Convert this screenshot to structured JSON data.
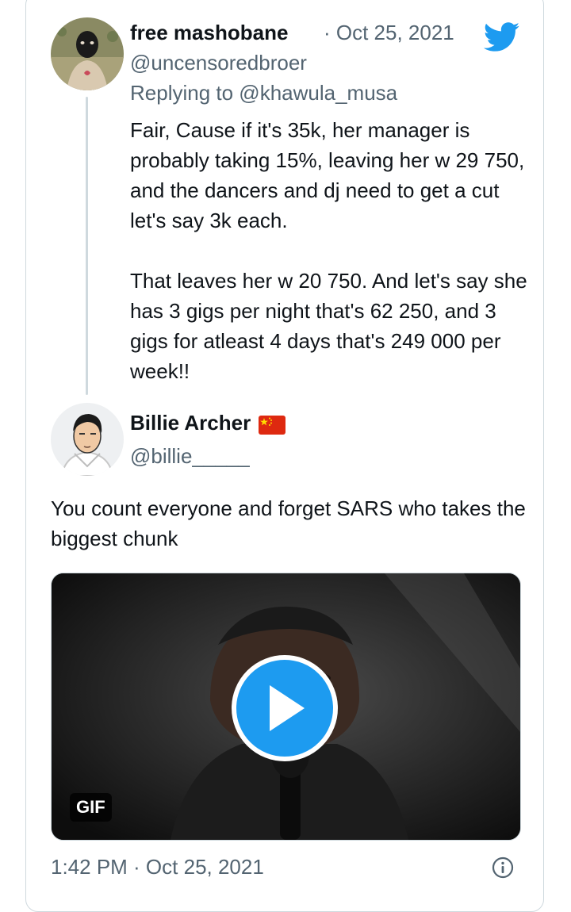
{
  "parent_tweet": {
    "display_name": "free mashobane",
    "date": "· Oct 25, 2021",
    "handle": "@uncensoredbroer",
    "replying_to": "Replying to @khawula_musa",
    "paragraph_1": "Fair, Cause if it's 35k, her manager is probably taking 15%, leaving her w 29 750, and the dancers and dj need to get a cut let's say 3k each.",
    "paragraph_2": "That leaves her w 20 750. And let's say she has 3 gigs per night that's 62 250, and 3 gigs for atleast 4 days that's 249 000 per week!!"
  },
  "main_tweet": {
    "display_name": "Billie Archer",
    "flag": "china-flag",
    "handle": "@billie_____",
    "text": "You count everyone and forget SARS who takes the biggest chunk",
    "media": {
      "badge": "GIF",
      "play_icon": "play-icon"
    },
    "timestamp": "1:42 PM · Oct 25, 2021"
  },
  "icons": {
    "platform": "twitter-bird-icon",
    "info": "info-icon"
  },
  "colors": {
    "accent": "#1d9bf0",
    "secondary_text": "#536471",
    "border": "#cfd9de"
  }
}
